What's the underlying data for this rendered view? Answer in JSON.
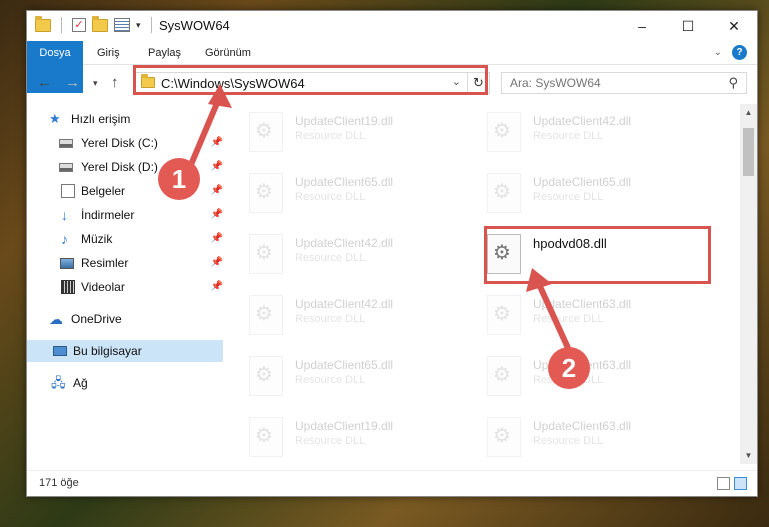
{
  "window": {
    "title": "SysWOW64",
    "controls": [
      "–",
      "☐",
      "✕"
    ]
  },
  "ribbon": {
    "tabs": [
      "Dosya",
      "Giriş",
      "Paylaş",
      "Görünüm"
    ]
  },
  "navigation": {
    "address_path": "C:\\Windows\\SysWOW64",
    "search_placeholder": "Ara: SysWOW64"
  },
  "sidebar": {
    "items": [
      {
        "label": "Hızlı erişim",
        "icon": "star-icon"
      },
      {
        "label": "Yerel Disk (C:)",
        "icon": "drive-icon",
        "pinned": true
      },
      {
        "label": "Yerel Disk (D:)",
        "icon": "drive-icon",
        "pinned": true
      },
      {
        "label": "Belgeler",
        "icon": "document-icon",
        "pinned": true
      },
      {
        "label": "İndirmeler",
        "icon": "download-icon",
        "pinned": true
      },
      {
        "label": "Müzik",
        "icon": "music-icon",
        "pinned": true
      },
      {
        "label": "Resimler",
        "icon": "pictures-icon",
        "pinned": true
      },
      {
        "label": "Videolar",
        "icon": "videos-icon",
        "pinned": true
      },
      {
        "label": "OneDrive",
        "icon": "cloud-icon"
      },
      {
        "label": "Bu bilgisayar",
        "icon": "computer-icon",
        "selected": true
      },
      {
        "label": "Ağ",
        "icon": "network-icon"
      }
    ]
  },
  "files": [
    {
      "name": "UpdateClient19.dll",
      "type": "Resource DLL"
    },
    {
      "name": "UpdateClient42.dll",
      "type": "Resource DLL"
    },
    {
      "name": "UpdateClient65.dll",
      "type": "Resource DLL"
    },
    {
      "name": "UpdateClient65.dll",
      "type": "Resource DLL"
    },
    {
      "name": "UpdateClient42.dll",
      "type": "Resource DLL"
    },
    {
      "name": "hpodvd08.dll",
      "type": ""
    },
    {
      "name": "UpdateClient42.dll",
      "type": "Resource DLL"
    },
    {
      "name": "UpdateClient63.dll",
      "type": "Resource DLL"
    },
    {
      "name": "UpdateClient65.dll",
      "type": "Resource DLL"
    },
    {
      "name": "UpdateClient63.dll",
      "type": "Resource DLL"
    },
    {
      "name": "UpdateClient19.dll",
      "type": "Resource DLL"
    },
    {
      "name": "UpdateClient63.dll",
      "type": "Resource DLL"
    }
  ],
  "status": {
    "item_count": "171 öğe"
  },
  "annotations": {
    "step1": "1",
    "step2": "2",
    "highlight_color": "#d9534f"
  }
}
